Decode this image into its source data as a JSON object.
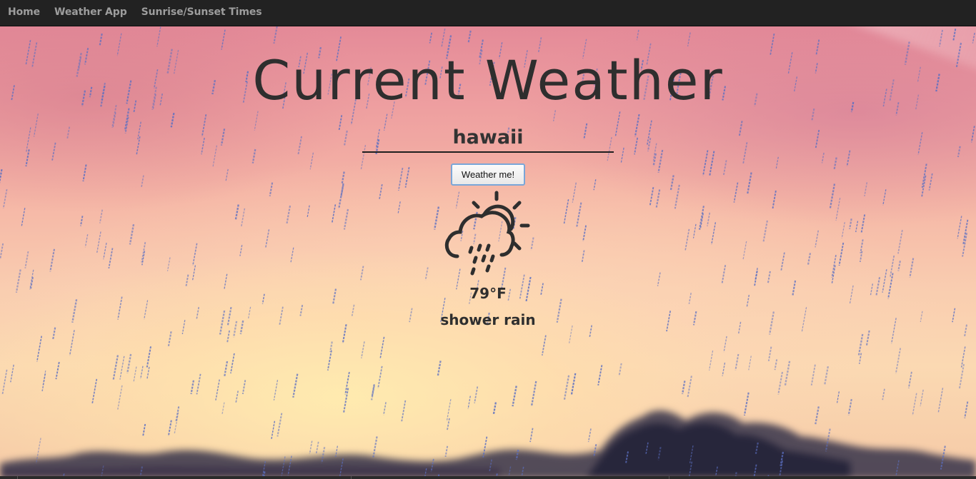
{
  "nav": {
    "links": [
      {
        "label": "Home"
      },
      {
        "label": "Weather App"
      },
      {
        "label": "Sunrise/Sunset Times"
      }
    ]
  },
  "main": {
    "title": "Current Weather",
    "search": {
      "value": "hawaii"
    },
    "button_label": "Weather me!",
    "weather": {
      "icon": "cloud-sun-rain-icon",
      "temperature": "79°F",
      "description": "shower rain"
    }
  },
  "colors": {
    "navbar": "#222222",
    "nav_text": "#9d9d9d",
    "title_text": "#2e2e2e",
    "rain": "#5b6fc2",
    "button_border": "#7aa6d8"
  }
}
